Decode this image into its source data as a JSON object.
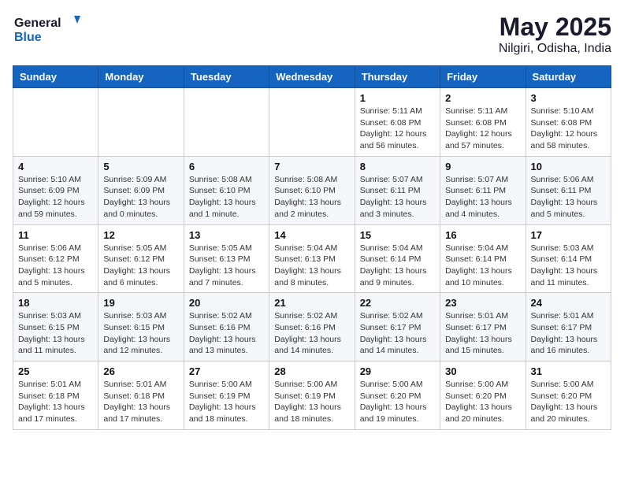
{
  "header": {
    "logo_line1": "General",
    "logo_line2": "Blue",
    "month_year": "May 2025",
    "location": "Nilgiri, Odisha, India"
  },
  "days_of_week": [
    "Sunday",
    "Monday",
    "Tuesday",
    "Wednesday",
    "Thursday",
    "Friday",
    "Saturday"
  ],
  "weeks": [
    [
      {
        "day": "",
        "info": ""
      },
      {
        "day": "",
        "info": ""
      },
      {
        "day": "",
        "info": ""
      },
      {
        "day": "",
        "info": ""
      },
      {
        "day": "1",
        "info": "Sunrise: 5:11 AM\nSunset: 6:08 PM\nDaylight: 12 hours\nand 56 minutes."
      },
      {
        "day": "2",
        "info": "Sunrise: 5:11 AM\nSunset: 6:08 PM\nDaylight: 12 hours\nand 57 minutes."
      },
      {
        "day": "3",
        "info": "Sunrise: 5:10 AM\nSunset: 6:08 PM\nDaylight: 12 hours\nand 58 minutes."
      }
    ],
    [
      {
        "day": "4",
        "info": "Sunrise: 5:10 AM\nSunset: 6:09 PM\nDaylight: 12 hours\nand 59 minutes."
      },
      {
        "day": "5",
        "info": "Sunrise: 5:09 AM\nSunset: 6:09 PM\nDaylight: 13 hours\nand 0 minutes."
      },
      {
        "day": "6",
        "info": "Sunrise: 5:08 AM\nSunset: 6:10 PM\nDaylight: 13 hours\nand 1 minute."
      },
      {
        "day": "7",
        "info": "Sunrise: 5:08 AM\nSunset: 6:10 PM\nDaylight: 13 hours\nand 2 minutes."
      },
      {
        "day": "8",
        "info": "Sunrise: 5:07 AM\nSunset: 6:11 PM\nDaylight: 13 hours\nand 3 minutes."
      },
      {
        "day": "9",
        "info": "Sunrise: 5:07 AM\nSunset: 6:11 PM\nDaylight: 13 hours\nand 4 minutes."
      },
      {
        "day": "10",
        "info": "Sunrise: 5:06 AM\nSunset: 6:11 PM\nDaylight: 13 hours\nand 5 minutes."
      }
    ],
    [
      {
        "day": "11",
        "info": "Sunrise: 5:06 AM\nSunset: 6:12 PM\nDaylight: 13 hours\nand 5 minutes."
      },
      {
        "day": "12",
        "info": "Sunrise: 5:05 AM\nSunset: 6:12 PM\nDaylight: 13 hours\nand 6 minutes."
      },
      {
        "day": "13",
        "info": "Sunrise: 5:05 AM\nSunset: 6:13 PM\nDaylight: 13 hours\nand 7 minutes."
      },
      {
        "day": "14",
        "info": "Sunrise: 5:04 AM\nSunset: 6:13 PM\nDaylight: 13 hours\nand 8 minutes."
      },
      {
        "day": "15",
        "info": "Sunrise: 5:04 AM\nSunset: 6:14 PM\nDaylight: 13 hours\nand 9 minutes."
      },
      {
        "day": "16",
        "info": "Sunrise: 5:04 AM\nSunset: 6:14 PM\nDaylight: 13 hours\nand 10 minutes."
      },
      {
        "day": "17",
        "info": "Sunrise: 5:03 AM\nSunset: 6:14 PM\nDaylight: 13 hours\nand 11 minutes."
      }
    ],
    [
      {
        "day": "18",
        "info": "Sunrise: 5:03 AM\nSunset: 6:15 PM\nDaylight: 13 hours\nand 11 minutes."
      },
      {
        "day": "19",
        "info": "Sunrise: 5:03 AM\nSunset: 6:15 PM\nDaylight: 13 hours\nand 12 minutes."
      },
      {
        "day": "20",
        "info": "Sunrise: 5:02 AM\nSunset: 6:16 PM\nDaylight: 13 hours\nand 13 minutes."
      },
      {
        "day": "21",
        "info": "Sunrise: 5:02 AM\nSunset: 6:16 PM\nDaylight: 13 hours\nand 14 minutes."
      },
      {
        "day": "22",
        "info": "Sunrise: 5:02 AM\nSunset: 6:17 PM\nDaylight: 13 hours\nand 14 minutes."
      },
      {
        "day": "23",
        "info": "Sunrise: 5:01 AM\nSunset: 6:17 PM\nDaylight: 13 hours\nand 15 minutes."
      },
      {
        "day": "24",
        "info": "Sunrise: 5:01 AM\nSunset: 6:17 PM\nDaylight: 13 hours\nand 16 minutes."
      }
    ],
    [
      {
        "day": "25",
        "info": "Sunrise: 5:01 AM\nSunset: 6:18 PM\nDaylight: 13 hours\nand 17 minutes."
      },
      {
        "day": "26",
        "info": "Sunrise: 5:01 AM\nSunset: 6:18 PM\nDaylight: 13 hours\nand 17 minutes."
      },
      {
        "day": "27",
        "info": "Sunrise: 5:00 AM\nSunset: 6:19 PM\nDaylight: 13 hours\nand 18 minutes."
      },
      {
        "day": "28",
        "info": "Sunrise: 5:00 AM\nSunset: 6:19 PM\nDaylight: 13 hours\nand 18 minutes."
      },
      {
        "day": "29",
        "info": "Sunrise: 5:00 AM\nSunset: 6:20 PM\nDaylight: 13 hours\nand 19 minutes."
      },
      {
        "day": "30",
        "info": "Sunrise: 5:00 AM\nSunset: 6:20 PM\nDaylight: 13 hours\nand 20 minutes."
      },
      {
        "day": "31",
        "info": "Sunrise: 5:00 AM\nSunset: 6:20 PM\nDaylight: 13 hours\nand 20 minutes."
      }
    ]
  ]
}
